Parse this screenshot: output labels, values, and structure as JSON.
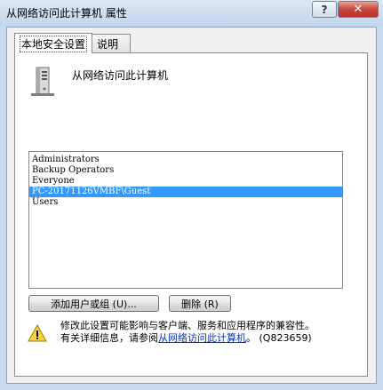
{
  "window": {
    "title": "从网络访问此计算机 属性",
    "help_label": "?",
    "close_label": "✕"
  },
  "tabs": [
    {
      "label": "本地安全设置"
    },
    {
      "label": "说明"
    }
  ],
  "policy": {
    "title": "从网络访问此计算机",
    "icon": "computer-server-icon"
  },
  "accounts": [
    {
      "label": "Administrators"
    },
    {
      "label": "Backup Operators"
    },
    {
      "label": "Everyone"
    },
    {
      "label": "PC-20171126VMBF\\Guest",
      "selected": true
    },
    {
      "label": "Users"
    }
  ],
  "buttons": {
    "add": "添加用户或组 (U)...",
    "remove": "删除 (R)"
  },
  "warning": {
    "icon": "warning-icon",
    "line1": "修改此设置可能影响与客户端、服务和应用程序的兼容性。",
    "line2_prefix": "有关详细信息，请参阅",
    "link": "从网络访问此计算机",
    "line2_suffix": "。 (Q823659)"
  }
}
